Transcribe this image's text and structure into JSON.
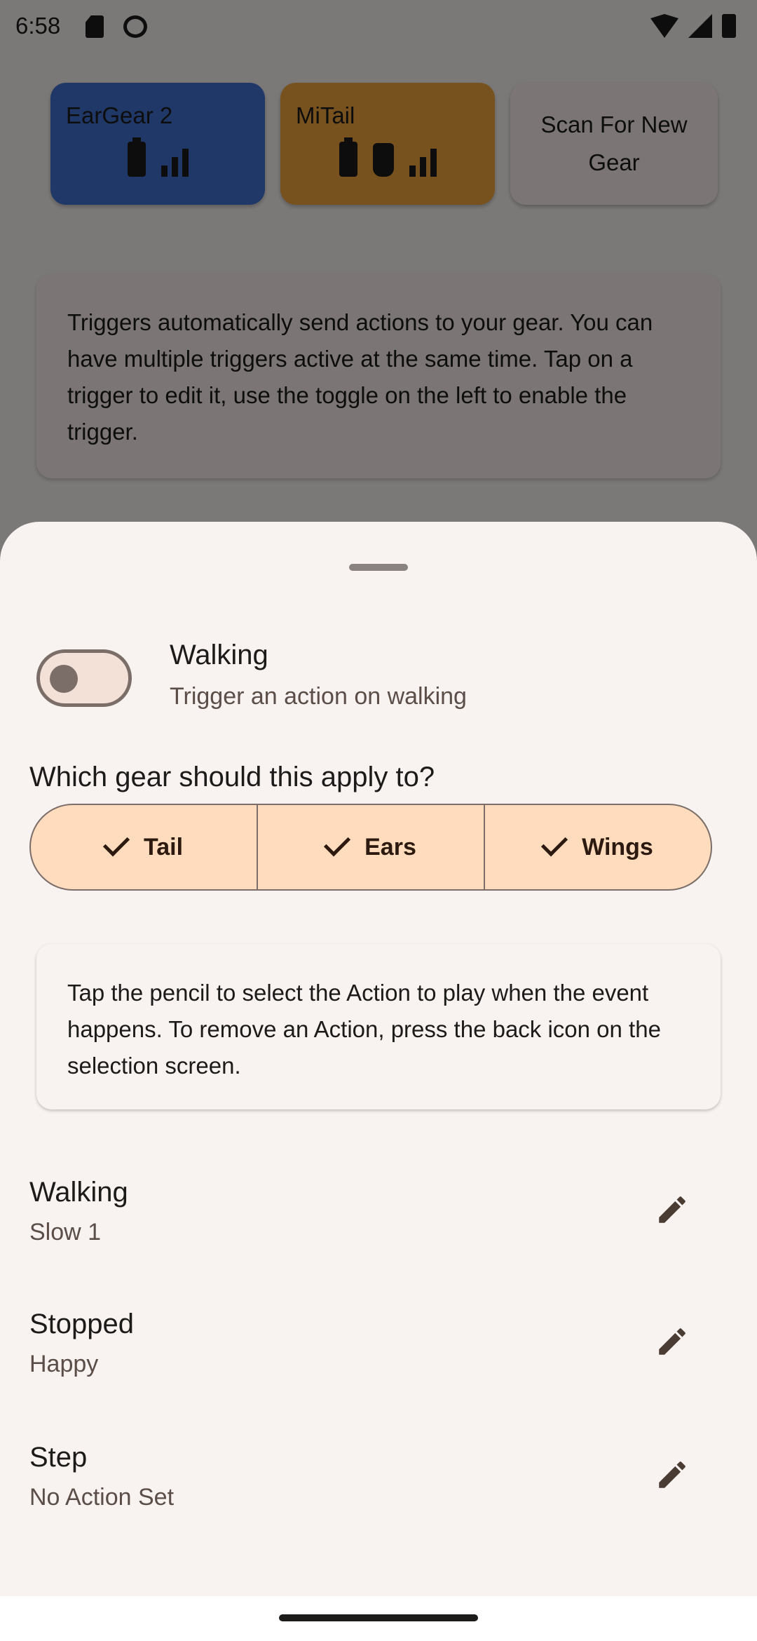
{
  "status": {
    "time": "6:58"
  },
  "gear_cards": [
    {
      "name": "EarGear 2",
      "color": "#3f70ce"
    },
    {
      "name": "MiTail",
      "color": "#f0a43c"
    }
  ],
  "scan_label": "Scan For New Gear",
  "triggers_info": "Triggers automatically send actions to your gear. You can have multiple triggers active at the same time. Tap on a trigger to edit it, use the toggle on the left to enable the trigger.",
  "sheet": {
    "trigger": {
      "title": "Walking",
      "subtitle": "Trigger an action on walking",
      "enabled": false
    },
    "gear_question": "Which gear should this apply to?",
    "gear_options": [
      {
        "label": "Tail",
        "selected": true
      },
      {
        "label": "Ears",
        "selected": true
      },
      {
        "label": "Wings",
        "selected": true
      }
    ],
    "tip": "Tap the pencil to select the Action to play when the event happens. To remove an Action, press the back icon on the selection screen.",
    "actions": [
      {
        "name": "Walking",
        "value": "Slow 1"
      },
      {
        "name": "Stopped",
        "value": "Happy"
      },
      {
        "name": "Step",
        "value": "No Action Set"
      }
    ]
  },
  "colors": {
    "accent": "#ffdcbd",
    "primary": "#7b6e68"
  }
}
